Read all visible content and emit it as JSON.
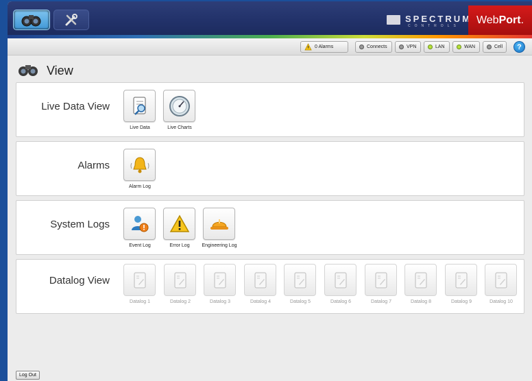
{
  "header": {
    "brand": "SPECTRUM",
    "brand_sub": "CONTROLS",
    "product_web": "Web",
    "product_port": "Port",
    "product_dot": "."
  },
  "status": {
    "alarms": "0 Alarms",
    "connects": "Connects",
    "vpn": "VPN",
    "lan": "LAN",
    "wan": "WAN",
    "cell": "Cell",
    "help": "?"
  },
  "page": {
    "title": "View"
  },
  "sections": {
    "live": {
      "label": "Live Data View",
      "items": [
        "Live Data",
        "Live Charts"
      ]
    },
    "alarms": {
      "label": "Alarms",
      "items": [
        "Alarm Log"
      ]
    },
    "logs": {
      "label": "System Logs",
      "items": [
        "Event Log",
        "Error Log",
        "Engineering Log"
      ]
    },
    "datalog": {
      "label": "Datalog View",
      "items": [
        "Datalog 1",
        "Datalog 2",
        "Datalog 3",
        "Datalog 4",
        "Datalog 5",
        "Datalog 6",
        "Datalog 7",
        "Datalog 8",
        "Datalog 9",
        "Datalog 10"
      ]
    }
  },
  "footer": {
    "logout": "Log Out"
  },
  "colors": {
    "background": "#1b4f9a",
    "header": "#22326a",
    "webport_red": "#c61414",
    "status_green": "#b7e03a",
    "status_gray": "#9a9a9a"
  },
  "icons": {
    "view": "binoculars-icon",
    "tools": "tools-icon",
    "alarms": "bell-warning-icon",
    "live_data": "notebook-magnifier-icon",
    "live_charts": "gauge-icon",
    "alarm_log": "bell-icon",
    "event_log": "user-warning-icon",
    "error_log": "warning-triangle-icon",
    "engineering_log": "hardhat-icon",
    "datalog": "document-icon",
    "help": "help-icon"
  }
}
